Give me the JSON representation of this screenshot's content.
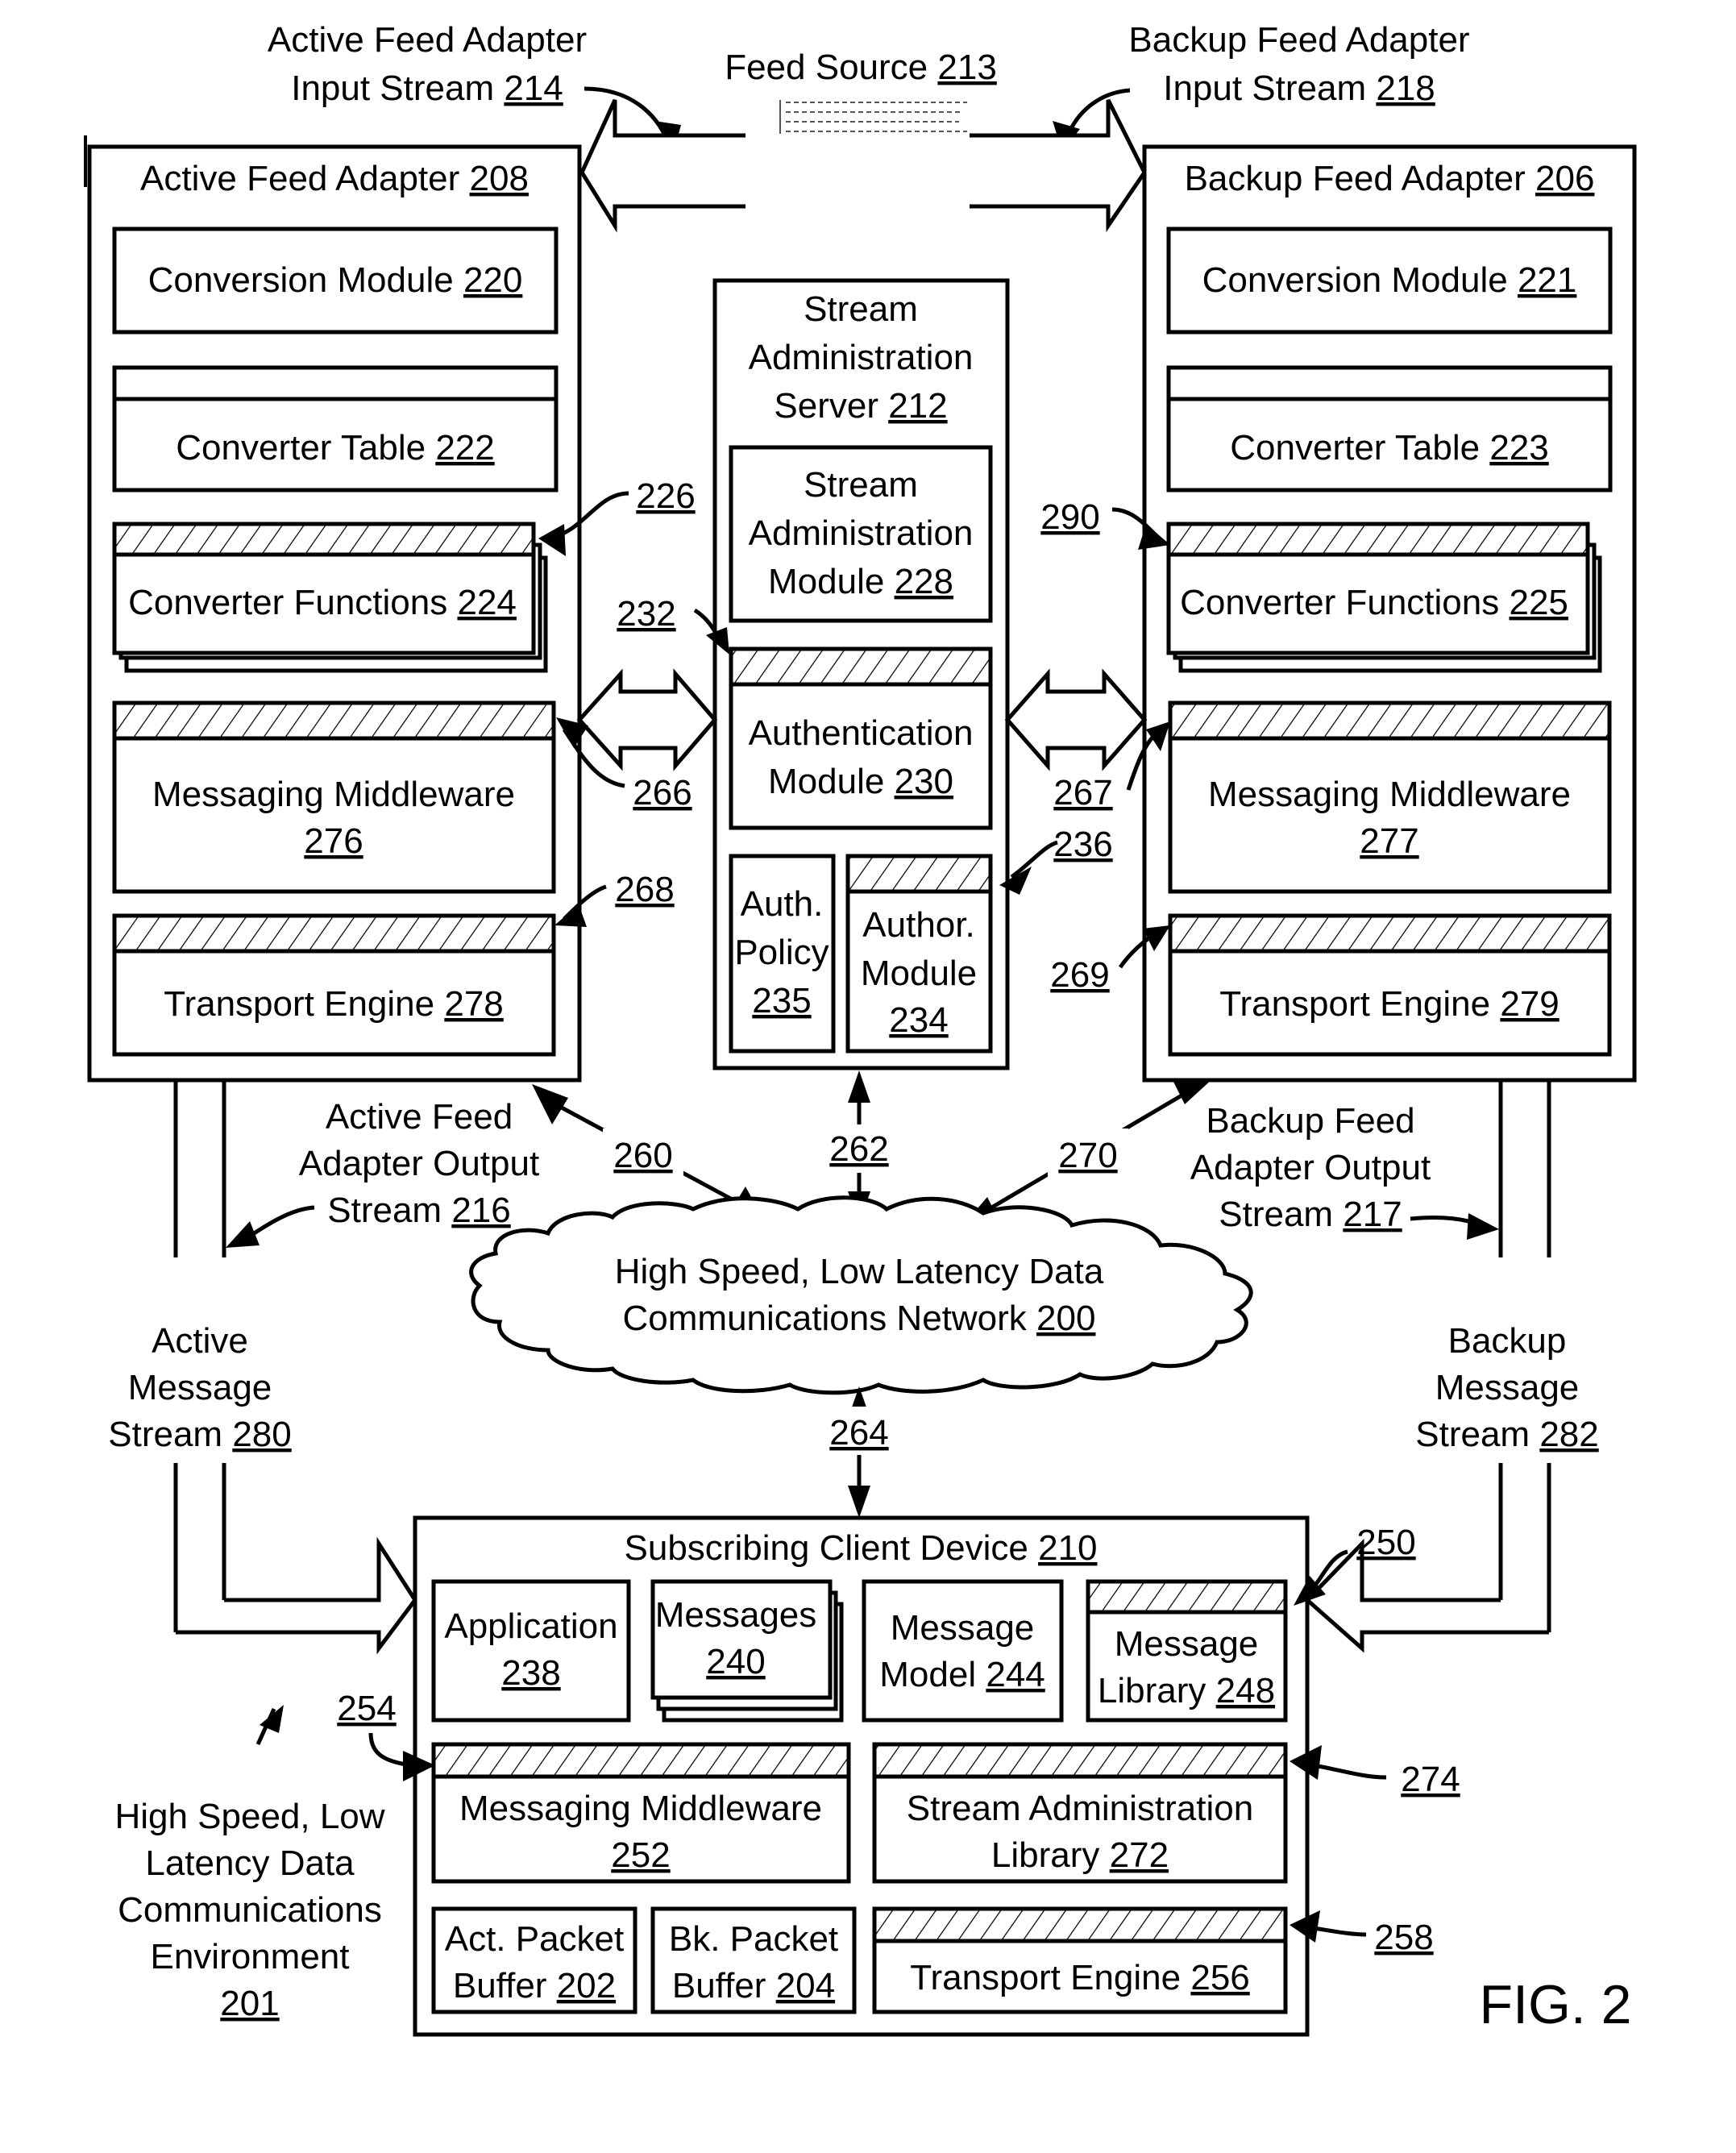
{
  "figure": {
    "label": "FIG. 2"
  },
  "feed_source": {
    "name": "Feed Source",
    "ref": "213"
  },
  "input_streams": {
    "active": {
      "line1": "Active Feed Adapter",
      "line2": "Input Stream",
      "ref": "214"
    },
    "backup": {
      "line1": "Backup Feed Adapter",
      "line2": "Input Stream",
      "ref": "218"
    }
  },
  "active_adapter": {
    "title": "Active Feed Adapter",
    "ref": "208",
    "conversion_module": {
      "name": "Conversion Module",
      "ref": "220"
    },
    "converter_table": {
      "name": "Converter Table",
      "ref": "222"
    },
    "converter_functions": {
      "name": "Converter Functions",
      "ref": "224"
    },
    "messaging_middleware": {
      "name": "Messaging Middleware",
      "ref": "276"
    },
    "transport_engine": {
      "name": "Transport Engine",
      "ref": "278"
    }
  },
  "backup_adapter": {
    "title": "Backup Feed Adapter",
    "ref": "206",
    "conversion_module": {
      "name": "Conversion Module",
      "ref": "221"
    },
    "converter_table": {
      "name": "Converter Table",
      "ref": "223"
    },
    "converter_functions": {
      "name": "Converter Functions",
      "ref": "225"
    },
    "messaging_middleware": {
      "name": "Messaging Middleware",
      "ref": "277"
    },
    "transport_engine": {
      "name": "Transport Engine",
      "ref": "279"
    }
  },
  "stream_admin_server": {
    "line1": "Stream",
    "line2": "Administration",
    "line3": "Server",
    "ref": "212",
    "admin_module": {
      "line1": "Stream",
      "line2": "Administration",
      "line3": "Module",
      "ref": "228"
    },
    "auth_module": {
      "line1": "Authentication",
      "line2": "Module",
      "ref": "230"
    },
    "auth_policy": {
      "line1": "Auth.",
      "line2": "Policy",
      "ref": "235"
    },
    "author_module": {
      "line1": "Author.",
      "line2": "Module",
      "ref": "234"
    }
  },
  "callouts": {
    "c226": "226",
    "c290": "290",
    "c232": "232",
    "c266": "266",
    "c267": "267",
    "c236": "236",
    "c268": "268",
    "c269": "269",
    "c260": "260",
    "c262": "262",
    "c270": "270",
    "c264": "264",
    "c250": "250",
    "c254": "254",
    "c274": "274",
    "c258": "258"
  },
  "output_streams": {
    "active": {
      "line1": "Active Feed",
      "line2": "Adapter Output",
      "line3": "Stream",
      "ref": "216"
    },
    "backup": {
      "line1": "Backup Feed",
      "line2": "Adapter Output",
      "line3": "Stream",
      "ref": "217"
    }
  },
  "message_streams": {
    "active": {
      "line1": "Active",
      "line2": "Message",
      "line3": "Stream",
      "ref": "280"
    },
    "backup": {
      "line1": "Backup",
      "line2": "Message",
      "line3": "Stream",
      "ref": "282"
    }
  },
  "network": {
    "line1": "High Speed, Low Latency Data",
    "line2": "Communications Network",
    "ref": "200"
  },
  "environment": {
    "line1": "High Speed, Low",
    "line2": "Latency Data",
    "line3": "Communications",
    "line4": "Environment",
    "ref": "201"
  },
  "client": {
    "title": "Subscribing Client Device",
    "ref": "210",
    "application": {
      "line1": "Application",
      "ref": "238"
    },
    "messages": {
      "line1": "Messages",
      "ref": "240"
    },
    "message_model": {
      "line1": "Message",
      "line2": "Model",
      "ref": "244"
    },
    "message_library": {
      "line1": "Message",
      "line2": "Library",
      "ref": "248"
    },
    "messaging_middleware": {
      "line1": "Messaging Middleware",
      "ref": "252"
    },
    "stream_admin_library": {
      "line1": "Stream Administration",
      "line2": "Library",
      "ref": "272"
    },
    "act_buffer": {
      "line1": "Act. Packet",
      "line2": "Buffer",
      "ref": "202"
    },
    "bk_buffer": {
      "line1": "Bk. Packet",
      "line2": "Buffer",
      "ref": "204"
    },
    "transport_engine": {
      "line1": "Transport Engine",
      "ref": "256"
    }
  }
}
